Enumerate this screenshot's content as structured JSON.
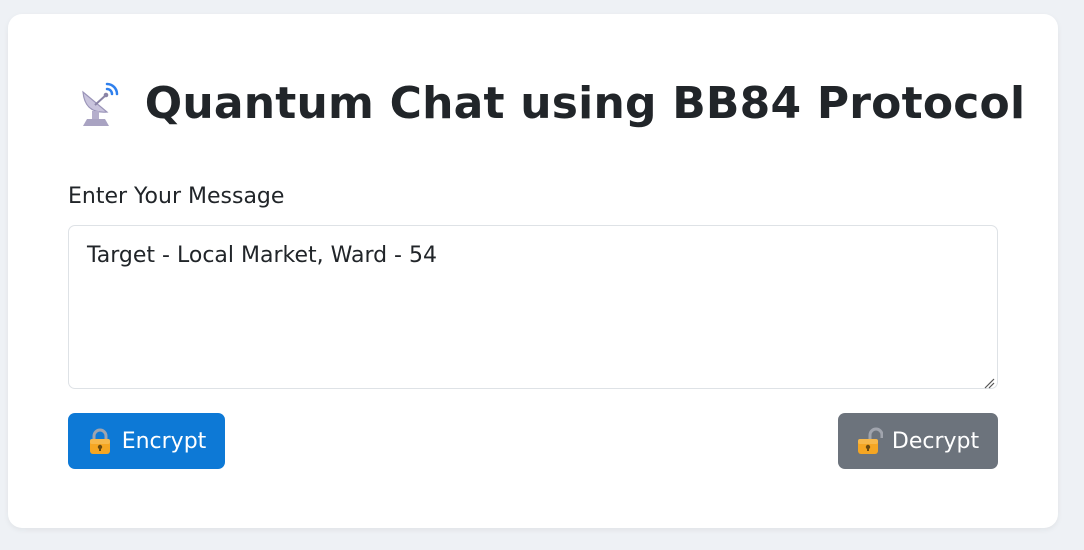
{
  "header": {
    "title": "Quantum Chat using BB84 Protocol",
    "icon": "satellite-antenna-icon"
  },
  "form": {
    "label": "Enter Your Message",
    "message_value": "Target - Local Market, Ward - 54"
  },
  "actions": {
    "encrypt_label": "Encrypt",
    "encrypt_icon": "locked-padlock-icon",
    "decrypt_label": "Decrypt",
    "decrypt_icon": "unlocked-padlock-icon"
  },
  "colors": {
    "primary": "#0d79d6",
    "secondary": "#6c737c",
    "background": "#eef1f5"
  }
}
